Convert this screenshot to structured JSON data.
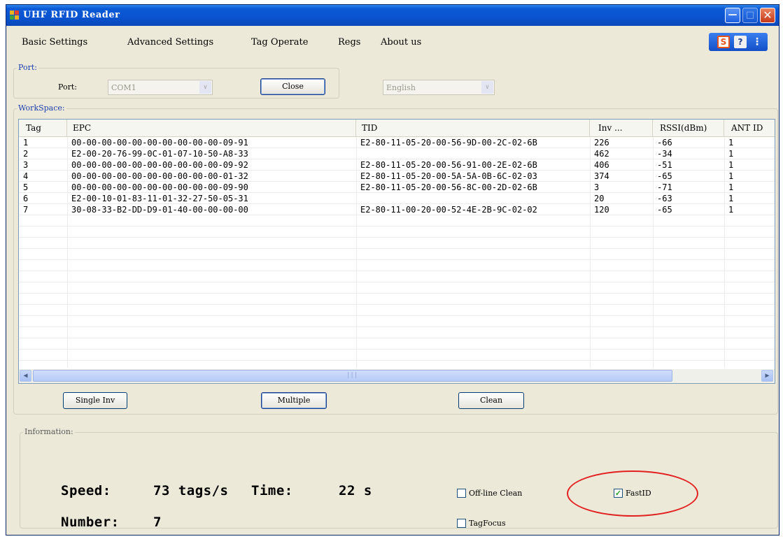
{
  "window": {
    "title": "UHF RFID Reader"
  },
  "menu": [
    "Basic Settings",
    "Advanced Settings",
    "Tag Operate",
    "Regs",
    "About us"
  ],
  "toolbox": {
    "items": [
      "sogou-s-icon",
      "help-icon",
      "more-icon"
    ],
    "s_label": "S",
    "help_label": "?"
  },
  "port_group": {
    "label": "Port:",
    "port_label": "Port:",
    "port_value": "COM1",
    "close_button": "Close",
    "language_value": "English"
  },
  "workspace": {
    "label": "WorkSpace:",
    "columns": [
      "Tag",
      "EPC",
      "TID",
      "Inv ...",
      "RSSI(dBm)",
      "ANT ID"
    ],
    "rows": [
      [
        "1",
        "00-00-00-00-00-00-00-00-00-00-09-91",
        "E2-80-11-05-20-00-56-9D-00-2C-02-6B",
        "226",
        "-66",
        "1"
      ],
      [
        "2",
        "E2-00-20-76-99-0C-01-07-10-50-A8-33",
        "",
        "462",
        "-34",
        "1"
      ],
      [
        "3",
        "00-00-00-00-00-00-00-00-00-00-09-92",
        "E2-80-11-05-20-00-56-91-00-2E-02-6B",
        "406",
        "-51",
        "1"
      ],
      [
        "4",
        "00-00-00-00-00-00-00-00-00-00-01-32",
        "E2-80-11-05-20-00-5A-5A-0B-6C-02-03",
        "374",
        "-65",
        "1"
      ],
      [
        "5",
        "00-00-00-00-00-00-00-00-00-00-09-90",
        "E2-80-11-05-20-00-56-8C-00-2D-02-6B",
        "3",
        "-71",
        "1"
      ],
      [
        "6",
        "E2-00-10-01-83-11-01-32-27-50-05-31",
        "",
        "20",
        "-63",
        "1"
      ],
      [
        "7",
        "30-08-33-B2-DD-D9-01-40-00-00-00-00",
        "E2-80-11-00-20-00-52-4E-2B-9C-02-02",
        "120",
        "-65",
        "1"
      ]
    ],
    "buttons": {
      "single": "Single Inv",
      "multiple": "Multiple",
      "clean": "Clean"
    }
  },
  "information": {
    "label": "Information:",
    "speed_label": "Speed:",
    "speed_value": "73 tags/s",
    "time_label": "Time:",
    "time_value": "22 s",
    "number_label": "Number:",
    "number_value": "7",
    "offline_clean": {
      "label": "Off-line Clean",
      "checked": false
    },
    "fastid": {
      "label": "FastID",
      "checked": true
    },
    "tagfocus": {
      "label": "TagFocus",
      "checked": false
    }
  },
  "colors": {
    "title_bar": "#0b5ad6",
    "annotation_ellipse": "#e32020",
    "group_label": "#1c3fb0"
  }
}
